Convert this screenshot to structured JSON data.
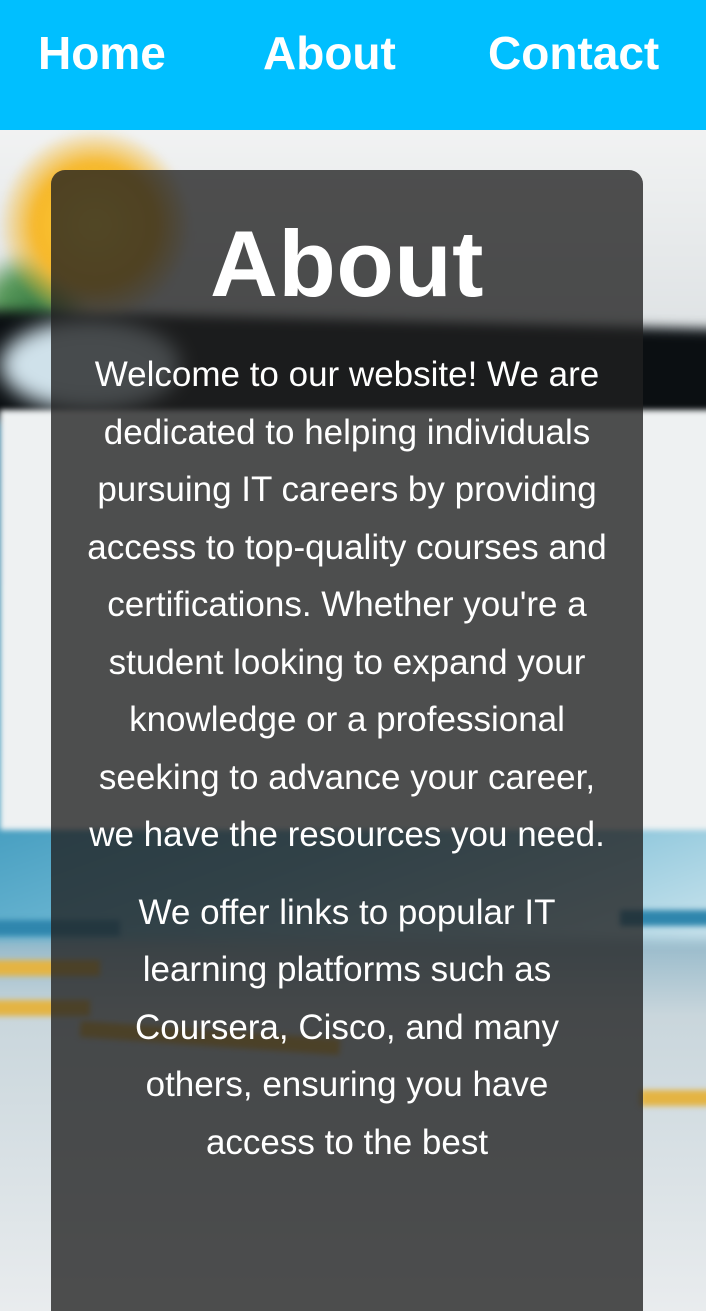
{
  "nav": {
    "links": [
      {
        "label": "Home"
      },
      {
        "label": "About"
      },
      {
        "label": "Contact"
      }
    ],
    "background_color": "#00bfff",
    "text_color": "#ffffff"
  },
  "about": {
    "heading": "About",
    "paragraphs": [
      "Welcome to our website! We are dedicated to helping individuals pursuing IT careers by providing access to top-quality courses and certifications. Whether you're a student looking to expand your knowledge or a professional seeking to advance your career, we have the resources you need.",
      "We offer links to popular IT learning platforms such as Coursera, Cisco, and many others, ensuring you have access to the best"
    ],
    "card_color": "rgba(32,32,32,0.78)"
  }
}
